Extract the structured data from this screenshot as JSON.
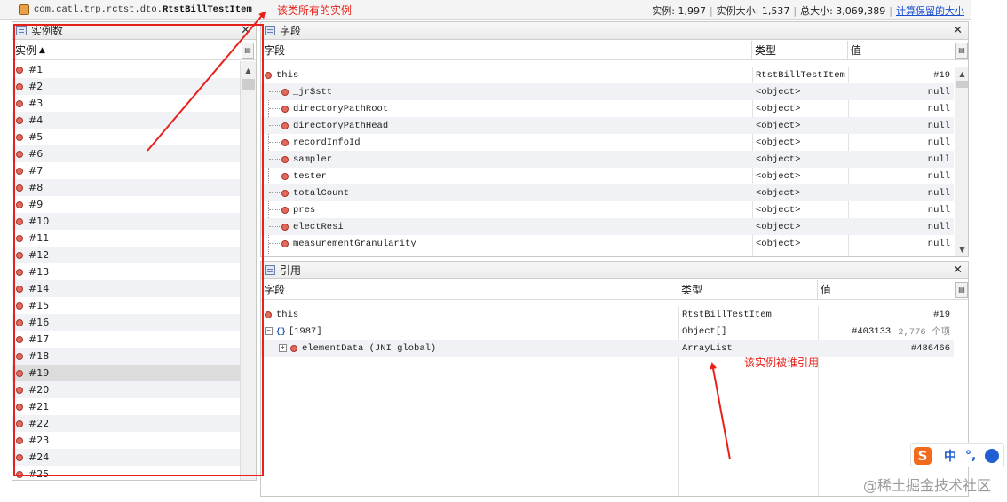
{
  "header": {
    "class_prefix": "com.catl.trp.rctst.dto.",
    "class_name": "RtstBillTestItem",
    "stats": {
      "instances": "实例: 1,997",
      "instance_size": "实例大小: 1,537",
      "total_size": "总大小: 3,069,389",
      "retained_link": "计算保留的大小"
    }
  },
  "instances_panel": {
    "title": "实例数",
    "column": "实例",
    "sort_indicator": "▲",
    "rows": [
      "#1",
      "#2",
      "#3",
      "#4",
      "#5",
      "#6",
      "#7",
      "#8",
      "#9",
      "#10",
      "#11",
      "#12",
      "#13",
      "#14",
      "#15",
      "#16",
      "#17",
      "#18",
      "#19",
      "#20",
      "#21",
      "#22",
      "#23",
      "#24",
      "#25"
    ],
    "selected": "#19"
  },
  "fields_panel": {
    "title": "字段",
    "columns": [
      "字段",
      "类型",
      "值"
    ],
    "rows": [
      {
        "name": "this",
        "type": "RtstBillTestItem",
        "value": "#19",
        "root": true
      },
      {
        "name": "_jr$stt",
        "type": "<object>",
        "value": "null"
      },
      {
        "name": "directoryPathRoot",
        "type": "<object>",
        "value": "null"
      },
      {
        "name": "directoryPathHead",
        "type": "<object>",
        "value": "null"
      },
      {
        "name": "recordInfoId",
        "type": "<object>",
        "value": "null"
      },
      {
        "name": "sampler",
        "type": "<object>",
        "value": "null"
      },
      {
        "name": "tester",
        "type": "<object>",
        "value": "null"
      },
      {
        "name": "totalCount",
        "type": "<object>",
        "value": "null"
      },
      {
        "name": "pres",
        "type": "<object>",
        "value": "null"
      },
      {
        "name": "electResi",
        "type": "<object>",
        "value": "null"
      },
      {
        "name": "measurementGranularity",
        "type": "<object>",
        "value": "null"
      }
    ]
  },
  "references_panel": {
    "title": "引用",
    "columns": [
      "字段",
      "类型",
      "值"
    ],
    "rows": [
      {
        "name": "this",
        "type": "RtstBillTestItem",
        "value": "#19",
        "extra": ""
      },
      {
        "name": "[1987]",
        "type": "Object[]",
        "value": "#403133",
        "extra": "2,776 个项"
      },
      {
        "name": "elementData (JNI global)",
        "type": "ArrayList",
        "value": "#486466",
        "extra": ""
      }
    ]
  },
  "annotations": {
    "all_instances": "该类所有的实例",
    "referenced_by": "该实例被谁引用"
  },
  "watermark": "@稀土掘金技术社区",
  "ime": {
    "logo": "S",
    "mode": "中",
    "punct": "°,"
  },
  "colors": {
    "annotation": "#e8201a",
    "link": "#1a4fd0",
    "object_dot": "#e26a5c"
  }
}
